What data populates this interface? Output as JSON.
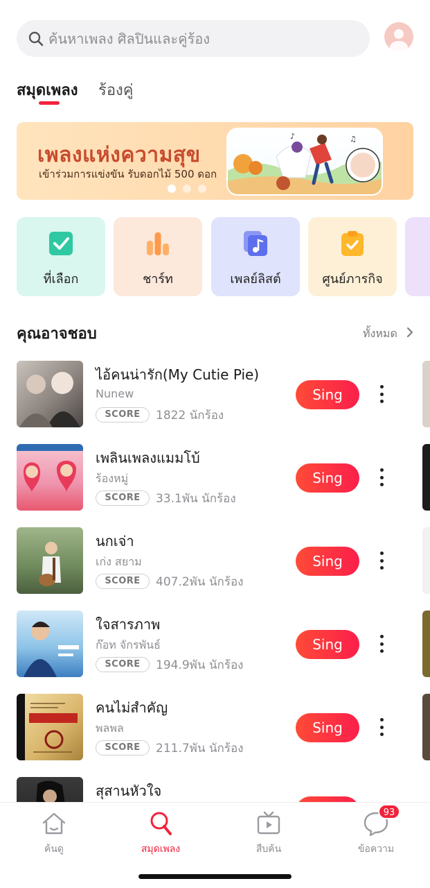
{
  "search": {
    "placeholder": "ค้นหาเพลง ศิลปินและคู่ร้อง",
    "icon": "search-icon"
  },
  "tabs": [
    {
      "label": "สมุดเพลง",
      "active": true
    },
    {
      "label": "ร้องคู่",
      "active": false
    }
  ],
  "banner": {
    "title": "เพลงแห่งความสุข",
    "subtitle": "เข้าร่วมการแข่งขัน รับดอกไม้ 500 ดอก",
    "slide_count": 3,
    "active_slide": 1
  },
  "categories": [
    {
      "label": "ที่เลือก",
      "icon": "checkbox-icon",
      "color": "#2ec9a2"
    },
    {
      "label": "ชาร์ท",
      "icon": "bar-chart-icon",
      "color": "#ff9a4a"
    },
    {
      "label": "เพลย์ลิสต์",
      "icon": "playlist-icon",
      "color": "#6a7af0"
    },
    {
      "label": "ศูนย์ภารกิจ",
      "icon": "clipboard-icon",
      "color": "#ffb72b"
    }
  ],
  "section": {
    "title": "คุณอาจชอบ",
    "see_all": "ทั้งหมด"
  },
  "songs": [
    {
      "title": "ไอ้คนน่ารัก(My Cutie Pie)",
      "artist": "Nunew",
      "badge": "SCORE",
      "singers": "1822 นักร้อง",
      "button": "Sing"
    },
    {
      "title": "เพลินเพลงแมมโบ้",
      "artist": "ร้องหมู่",
      "badge": "SCORE",
      "singers": "33.1พัน นักร้อง",
      "button": "Sing"
    },
    {
      "title": "นกเจ่า",
      "artist": "เก่ง สยาม",
      "badge": "SCORE",
      "singers": "407.2พัน นักร้อง",
      "button": "Sing"
    },
    {
      "title": "ใจสารภาพ",
      "artist": "ก๊อท จักรพันธ์",
      "badge": "SCORE",
      "singers": "194.9พัน นักร้อง",
      "button": "Sing"
    },
    {
      "title": "คนไม่สำคัญ",
      "artist": "พลพล",
      "badge": "SCORE",
      "singers": "211.7พัน นักร้อง",
      "button": "Sing"
    },
    {
      "title": "สุสานหัวใจ",
      "artist": "",
      "badge": "",
      "singers": "",
      "button": ""
    }
  ],
  "tabbar": [
    {
      "label": "ค้นดู",
      "icon": "home-icon",
      "active": false
    },
    {
      "label": "สมุดเพลง",
      "icon": "microphone-icon",
      "active": true
    },
    {
      "label": "สืบค้น",
      "icon": "tv-icon",
      "active": false
    },
    {
      "label": "ข้อความ",
      "icon": "chat-icon",
      "active": false,
      "badge": "93"
    }
  ],
  "colors": {
    "accent": "#f1233b",
    "sing_button": "#fb2f45"
  }
}
